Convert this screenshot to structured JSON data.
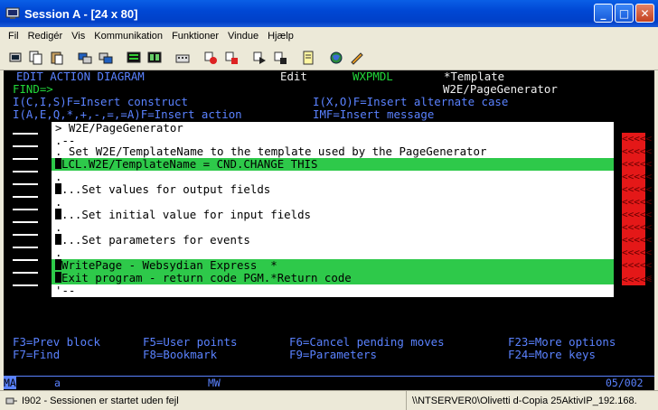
{
  "window": {
    "title": "Session A - [24 x 80]",
    "buttons": {
      "minimize": "_",
      "maximize": "□",
      "close": "✕"
    }
  },
  "menu": [
    "Fil",
    "Redigér",
    "Vis",
    "Kommunikation",
    "Funktioner",
    "Vindue",
    "Hjælp"
  ],
  "toolbar_icons": [
    "print-screen-icon",
    "copy-icon",
    "paste-icon",
    "send-file-icon",
    "receive-file-icon",
    "display-settings-icon",
    "keyboard-map-icon",
    "keypad-icon",
    "macro-record-icon",
    "macro-stop-icon",
    "macro-play-icon",
    "macro-edit-icon",
    "notes-icon",
    "globe-icon",
    "help-icon"
  ],
  "terminal": {
    "header_left": "EDIT ACTION DIAGRAM",
    "header_mode": "Edit",
    "header_model": "WXPMDL",
    "header_template": "*Template",
    "find_label": "FIND=>",
    "function_name": "W2E/PageGenerator",
    "help_line1_left": "I(C,I,S)F=Insert construct",
    "help_line1_right": "I(X,O)F=Insert alternate case",
    "help_line2_left": "I(A,E,Q,*,+,-,=,=A)F=Insert action",
    "help_line2_right": "IMF=Insert message",
    "popup": {
      "lines": [
        "> W2E/PageGenerator",
        ".--",
        ". Set W2E/TemplateName to the template used by the PageGenerator",
        "LCL.W2E/TemplateName = CND.CHANGE THIS",
        ".",
        "...Set values for output fields",
        ".",
        "...Set initial value for input fields",
        ".",
        "...Set parameters for events",
        ".",
        "WritePage - Websydian Express  *",
        "Exit program - return code PGM.*Return code",
        "'--"
      ]
    },
    "right_markers": [
      "<<<<<",
      "<<<<<",
      "<<<<<",
      "<<<<<",
      "<<<<<",
      "<<<<<",
      "<<<<<",
      "<<<<<",
      "<<<<<",
      "<<<<<",
      "<<<<<",
      "<<<<<",
      "<<<<<"
    ],
    "fkeys": {
      "row1": [
        "F3=Prev block",
        "F5=User points",
        "F6=Cancel pending moves",
        "F23=More options"
      ],
      "row2": [
        "F7=Find",
        "F8=Bookmark",
        "F9=Parameters",
        "F24=More keys"
      ]
    },
    "oia": {
      "ma": "MA",
      "a": "a",
      "mw": "MW",
      "pos": "05/002"
    }
  },
  "status": {
    "message": "I902 - Sessionen er startet uden fejl",
    "connection": "\\\\NTSERVER0\\Olivetti d-Copia 25AktivIP_192.168."
  },
  "colors": {
    "terminal_bg": "#000000",
    "field_blue": "#5a82ff",
    "field_green": "#22d83a",
    "highlight": "#2ec94a",
    "alert_red": "#e41818"
  }
}
